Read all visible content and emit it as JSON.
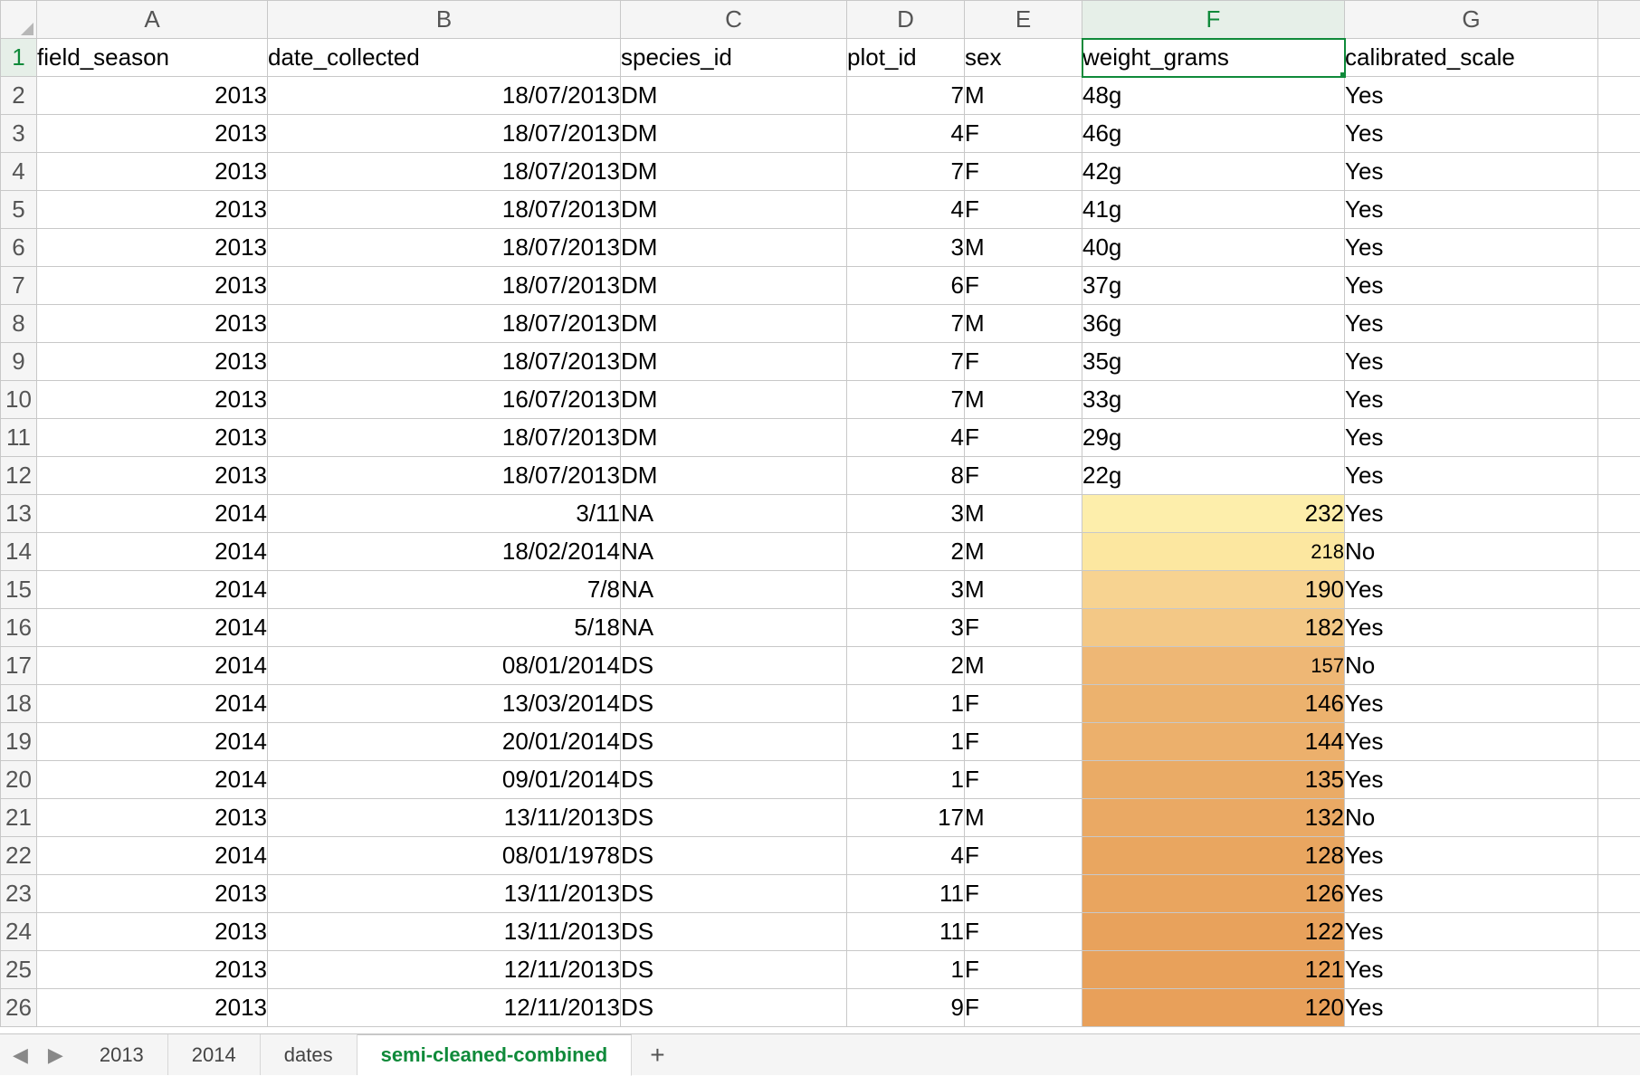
{
  "columns": [
    "A",
    "B",
    "C",
    "D",
    "E",
    "F",
    "G"
  ],
  "headers": {
    "A": "field_season",
    "B": "date_collected",
    "C": "species_id",
    "D": "plot_id",
    "E": "sex",
    "F": "weight_grams",
    "G": "calibrated_scale"
  },
  "active_col": "F",
  "active_row": 1,
  "rows": [
    {
      "n": 2,
      "A": "2013",
      "B": "18/07/2013",
      "C": "DM",
      "D": "7",
      "E": "M",
      "F": "48g",
      "G": "Yes",
      "Fnum": false
    },
    {
      "n": 3,
      "A": "2013",
      "B": "18/07/2013",
      "C": "DM",
      "D": "4",
      "E": "F",
      "F": "46g",
      "G": "Yes",
      "Fnum": false
    },
    {
      "n": 4,
      "A": "2013",
      "B": "18/07/2013",
      "C": "DM",
      "D": "7",
      "E": "F",
      "F": "42g",
      "G": "Yes",
      "Fnum": false
    },
    {
      "n": 5,
      "A": "2013",
      "B": "18/07/2013",
      "C": "DM",
      "D": "4",
      "E": "F",
      "F": "41g",
      "G": "Yes",
      "Fnum": false
    },
    {
      "n": 6,
      "A": "2013",
      "B": "18/07/2013",
      "C": "DM",
      "D": "3",
      "E": "M",
      "F": "40g",
      "G": "Yes",
      "Fnum": false
    },
    {
      "n": 7,
      "A": "2013",
      "B": "18/07/2013",
      "C": "DM",
      "D": "6",
      "E": "F",
      "F": "37g",
      "G": "Yes",
      "Fnum": false
    },
    {
      "n": 8,
      "A": "2013",
      "B": "18/07/2013",
      "C": "DM",
      "D": "7",
      "E": "M",
      "F": "36g",
      "G": "Yes",
      "Fnum": false
    },
    {
      "n": 9,
      "A": "2013",
      "B": "18/07/2013",
      "C": "DM",
      "D": "7",
      "E": "F",
      "F": "35g",
      "G": "Yes",
      "Fnum": false
    },
    {
      "n": 10,
      "A": "2013",
      "B": "16/07/2013",
      "C": "DM",
      "D": "7",
      "E": "M",
      "F": "33g",
      "G": "Yes",
      "Fnum": false
    },
    {
      "n": 11,
      "A": "2013",
      "B": "18/07/2013",
      "C": "DM",
      "D": "4",
      "E": "F",
      "F": "29g",
      "G": "Yes",
      "Fnum": false
    },
    {
      "n": 12,
      "A": "2013",
      "B": "18/07/2013",
      "C": "DM",
      "D": "8",
      "E": "F",
      "F": "22g",
      "G": "Yes",
      "Fnum": false
    },
    {
      "n": 13,
      "A": "2014",
      "B": "3/11",
      "C": "NA",
      "D": "3",
      "E": "M",
      "F": "232",
      "G": "Yes",
      "Fnum": true,
      "Fbg": "#fdeeab"
    },
    {
      "n": 14,
      "A": "2014",
      "B": "18/02/2014",
      "C": "NA",
      "D": "2",
      "E": "M",
      "F": "218",
      "G": "No",
      "Fnum": true,
      "Fbg": "#fce7a0",
      "Fsmall": true
    },
    {
      "n": 15,
      "A": "2014",
      "B": "7/8",
      "C": "NA",
      "D": "3",
      "E": "M",
      "F": "190",
      "G": "Yes",
      "Fnum": true,
      "Fbg": "#f7d391"
    },
    {
      "n": 16,
      "A": "2014",
      "B": "5/18",
      "C": "NA",
      "D": "3",
      "E": "F",
      "F": "182",
      "G": "Yes",
      "Fnum": true,
      "Fbg": "#f3c886"
    },
    {
      "n": 17,
      "A": "2014",
      "B": "08/01/2014",
      "C": "DS",
      "D": "2",
      "E": "M",
      "F": "157",
      "G": "No",
      "Fnum": true,
      "Fbg": "#eeb775",
      "Fsmall": true
    },
    {
      "n": 18,
      "A": "2014",
      "B": "13/03/2014",
      "C": "DS",
      "D": "1",
      "E": "F",
      "F": "146",
      "G": "Yes",
      "Fnum": true,
      "Fbg": "#ecb26e"
    },
    {
      "n": 19,
      "A": "2014",
      "B": "20/01/2014",
      "C": "DS",
      "D": "1",
      "E": "F",
      "F": "144",
      "G": "Yes",
      "Fnum": true,
      "Fbg": "#ecb06c"
    },
    {
      "n": 20,
      "A": "2014",
      "B": "09/01/2014",
      "C": "DS",
      "D": "1",
      "E": "F",
      "F": "135",
      "G": "Yes",
      "Fnum": true,
      "Fbg": "#eaab66"
    },
    {
      "n": 21,
      "A": "2013",
      "B": "13/11/2013",
      "C": "DS",
      "D": "17",
      "E": "M",
      "F": "132",
      "G": "No",
      "Fnum": true,
      "Fbg": "#eaa964"
    },
    {
      "n": 22,
      "A": "2014",
      "B": "08/01/1978",
      "C": "DS",
      "D": "4",
      "E": "F",
      "F": "128",
      "G": "Yes",
      "Fnum": true,
      "Fbg": "#e9a660"
    },
    {
      "n": 23,
      "A": "2013",
      "B": "13/11/2013",
      "C": "DS",
      "D": "11",
      "E": "F",
      "F": "126",
      "G": "Yes",
      "Fnum": true,
      "Fbg": "#e9a55f"
    },
    {
      "n": 24,
      "A": "2013",
      "B": "13/11/2013",
      "C": "DS",
      "D": "11",
      "E": "F",
      "F": "122",
      "G": "Yes",
      "Fnum": true,
      "Fbg": "#e8a25c"
    },
    {
      "n": 25,
      "A": "2013",
      "B": "12/11/2013",
      "C": "DS",
      "D": "1",
      "E": "F",
      "F": "121",
      "G": "Yes",
      "Fnum": true,
      "Fbg": "#e8a15b"
    },
    {
      "n": 26,
      "A": "2013",
      "B": "12/11/2013",
      "C": "DS",
      "D": "9",
      "E": "F",
      "F": "120",
      "G": "Yes",
      "Fnum": true,
      "Fbg": "#e8a05a"
    }
  ],
  "tabs": [
    {
      "label": "2013",
      "active": false
    },
    {
      "label": "2014",
      "active": false
    },
    {
      "label": "dates",
      "active": false
    },
    {
      "label": "semi-cleaned-combined",
      "active": true
    }
  ],
  "nav": {
    "prev": "◀",
    "next": "▶",
    "add": "+"
  }
}
